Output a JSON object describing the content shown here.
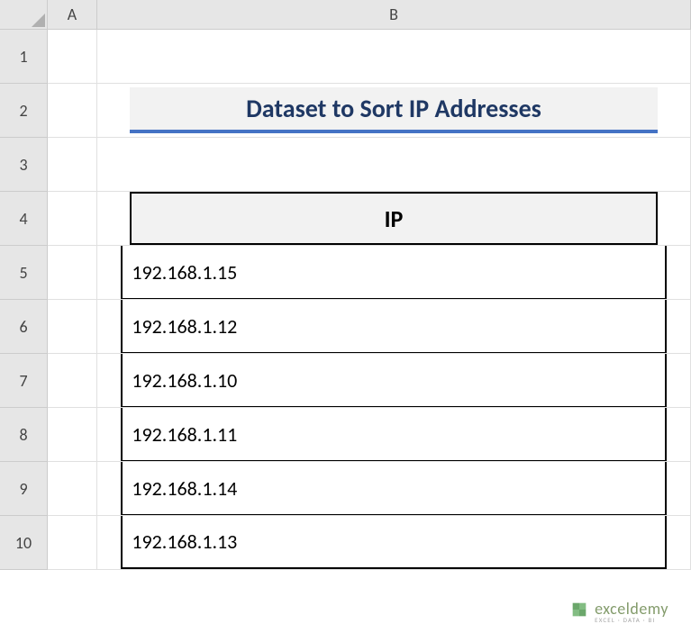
{
  "columns": [
    "A",
    "B"
  ],
  "rows": [
    "1",
    "2",
    "3",
    "4",
    "5",
    "6",
    "7",
    "8",
    "9",
    "10"
  ],
  "title": "Dataset to Sort IP Addresses",
  "table": {
    "header": "IP",
    "data": [
      "192.168.1.15",
      "192.168.1.12",
      "192.168.1.10",
      "192.168.1.11",
      "192.168.1.14",
      "192.168.1.13"
    ]
  },
  "watermark": {
    "main": "exceldemy",
    "sub": "EXCEL · DATA · BI"
  }
}
